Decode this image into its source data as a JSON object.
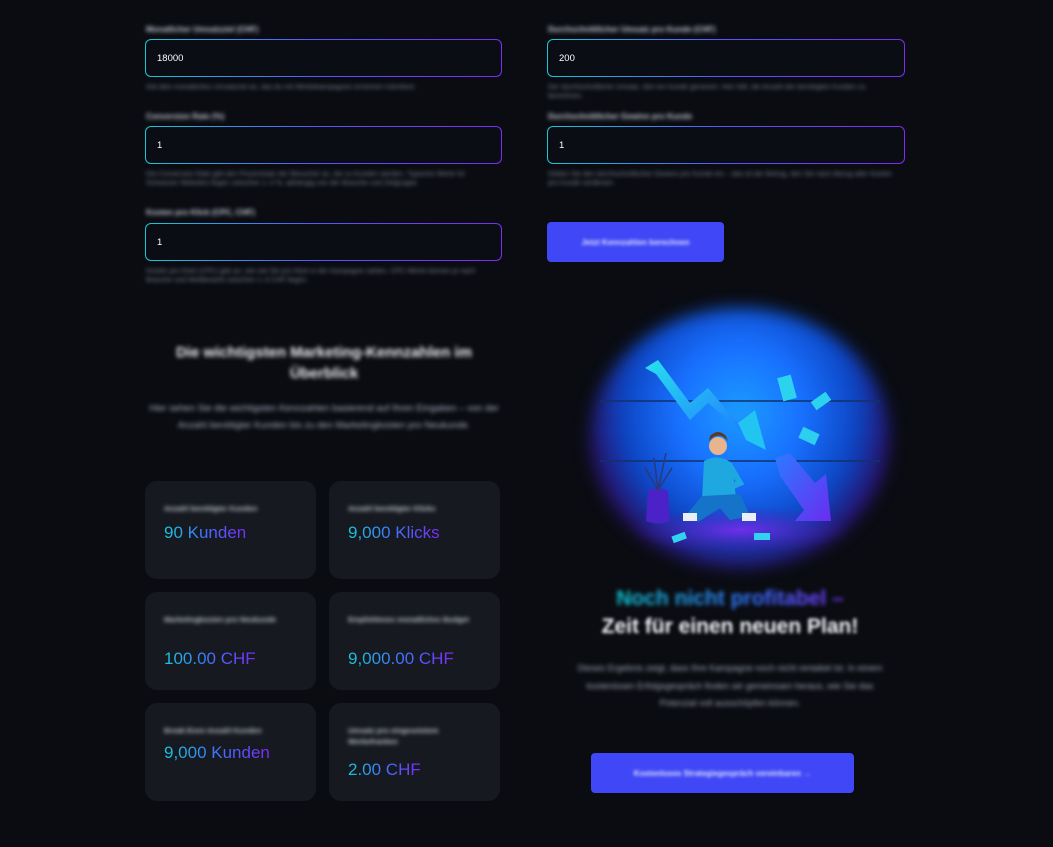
{
  "inputs": {
    "umsatz": {
      "label": "Monatlicher Umsatzziel (CHF)",
      "value": "18000",
      "help": "Gib dein monatliches Umsatzziel an, das du mit Werbekampagnen erreichen möchtest."
    },
    "conversion": {
      "label": "Conversion Rate (%)",
      "value": "1",
      "help": "Die Conversion Rate gibt den Prozentsatz der Besucher an, die zu Kunden werden. Typische Werte für Schweizer Websites liegen zwischen 1–3 %, abhängig von der Branche und Zielgruppe."
    },
    "cpc": {
      "label": "Kosten pro Klick (CPC, CHF)",
      "value": "1",
      "help": "Kosten pro Klick (CPC) gibt an, wie viel Sie pro Klick in der Kampagne zahlen. CPC-Werte können je nach Branche und Wettbewerb zwischen 1–5 CHF liegen."
    },
    "avg_umsatz": {
      "label": "Durchschnittlicher Umsatz pro Kunde (CHF)",
      "value": "200",
      "help": "Der durchschnittliche Umsatz, den ein Kunde generiert. Hier hilft, die Anzahl der benötigten Kunden zu berechnen."
    },
    "avg_gewinn": {
      "label": "Durchschnittlicher Gewinn pro Kunde",
      "value": "1",
      "help": "Geben Sie den durchschnittlichen Gewinn pro Kunde ein – das ist der Betrag, den Sie nach Abzug aller Kosten pro Kunde verdienen."
    }
  },
  "buttons": {
    "calculate": "Jetzt Kennzahlen berechnen",
    "cta": "Kostenloses Strategiegespräch vereinbaren →"
  },
  "section": {
    "title": "Die wichtigsten Marketing-Kennzahlen im Überblick",
    "desc": "Hier sehen Sie die wichtigsten Kennzahlen basierend auf Ihren Eingaben – von der Anzahl benötigter Kunden bis zu den Marketingkosten pro Neukunde."
  },
  "cards": [
    {
      "title": "Anzahl benötigter Kunden",
      "value": "90 Kunden"
    },
    {
      "title": "Anzahl benötigter Klicks",
      "value": "9,000 Klicks"
    },
    {
      "title": "Marketingkosten pro Neukunde",
      "value": "100.00 CHF"
    },
    {
      "title": "Empfohlenes monatliches Budget",
      "value": "9,000.00 CHF"
    },
    {
      "title": "Break-Even Anzahl Kunden",
      "value": "9,000 Kunden"
    },
    {
      "title": "Umsatz pro eingesetztem Werbefranken",
      "value": "2.00 CHF"
    }
  ],
  "result": {
    "headline_accent": "Noch nicht profitabel –",
    "headline": "Zeit für einen neuen Plan!",
    "desc": "Dieses Ergebnis zeigt, dass Ihre Kampagne noch nicht rentabel ist. In einem kostenlosen Erfolgsgespräch finden wir gemeinsam heraus, wie Sie das Potenzial voll ausschöpfen können."
  },
  "colors": {
    "accent": "#3f47f6",
    "background": "#0a0c12",
    "card": "#16191f"
  }
}
